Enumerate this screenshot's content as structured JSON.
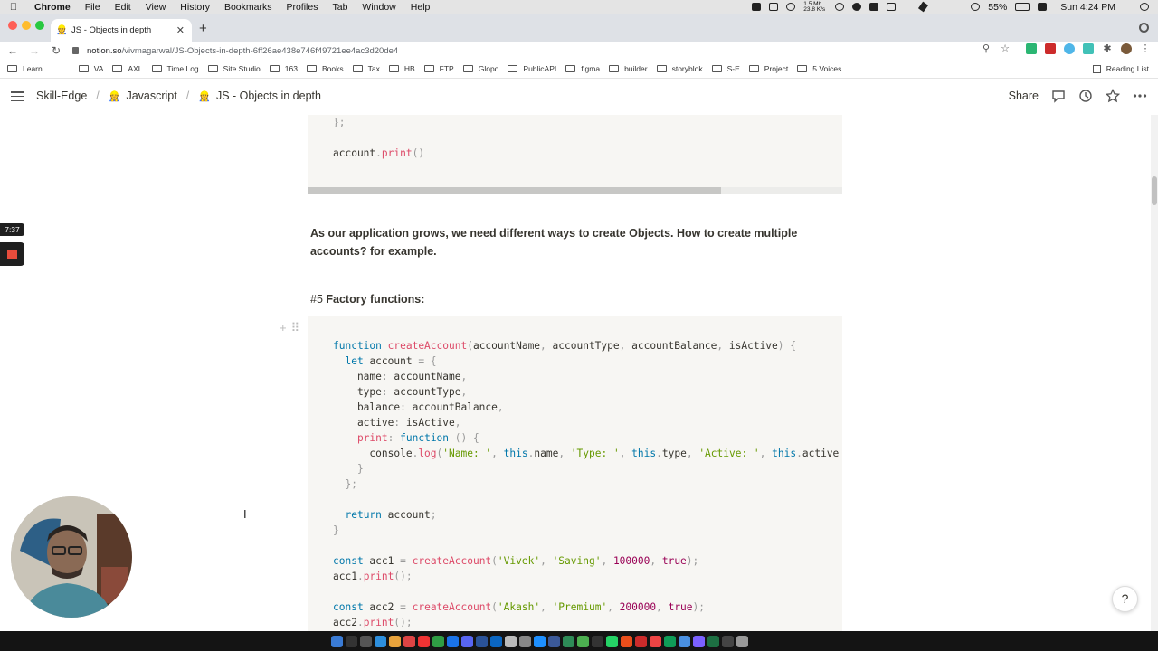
{
  "menubar": {
    "app_name": "Chrome",
    "menus": [
      "File",
      "Edit",
      "View",
      "History",
      "Bookmarks",
      "Profiles",
      "Tab",
      "Window",
      "Help"
    ],
    "net_up": "1.5 Mb",
    "net_down": "23.8 K/s",
    "battery": "55%",
    "clock": "Sun 4:24 PM"
  },
  "browser": {
    "tab_title": "JS - Objects in depth",
    "url_host": "notion.so",
    "url_path": "/vivmagarwal/JS-Objects-in-depth-6ff26ae438e746f49721ee4ac3d20de4",
    "bookmarks": [
      "Learn",
      "VA",
      "AXL",
      "Time Log",
      "Site Studio",
      "163",
      "Books",
      "Tax",
      "HB",
      "FTP",
      "Glopo",
      "PublicAPI",
      "figma",
      "builder",
      "storyblok",
      "S-E",
      "Project",
      "5 Voices"
    ],
    "reading_list": "Reading List"
  },
  "notion": {
    "breadcrumbs": [
      "Skill-Edge",
      "Javascript",
      "JS - Objects in depth"
    ],
    "share_label": "Share",
    "paragraph": "As our application grows, we need different ways to create Objects. How to create multiple accounts? for example.",
    "heading_prefix": "#5",
    "heading_text": "Factory functions:",
    "help_label": "?"
  },
  "recording": {
    "elapsed": "7:37"
  },
  "code_top": [
    [
      [
        "pun",
        "};"
      ]
    ],
    [],
    [
      [
        "",
        "account"
      ],
      [
        "pun",
        "."
      ],
      [
        "fn",
        "print"
      ],
      [
        "pun",
        "()"
      ]
    ]
  ],
  "code_main": [
    [
      [
        "kw",
        "function"
      ],
      [
        "",
        " "
      ],
      [
        "fn",
        "createAccount"
      ],
      [
        "pun",
        "("
      ],
      [
        "",
        "accountName"
      ],
      [
        "pun",
        ", "
      ],
      [
        "",
        "accountType"
      ],
      [
        "pun",
        ", "
      ],
      [
        "",
        "accountBalance"
      ],
      [
        "pun",
        ", "
      ],
      [
        "",
        "isActive"
      ],
      [
        "pun",
        ") {"
      ]
    ],
    [
      [
        "",
        "  "
      ],
      [
        "kw",
        "let"
      ],
      [
        "",
        " account "
      ],
      [
        "pun",
        "= {"
      ]
    ],
    [
      [
        "",
        "    name"
      ],
      [
        "pun",
        ":"
      ],
      [
        "",
        " accountName"
      ],
      [
        "pun",
        ","
      ]
    ],
    [
      [
        "",
        "    type"
      ],
      [
        "pun",
        ":"
      ],
      [
        "",
        " accountType"
      ],
      [
        "pun",
        ","
      ]
    ],
    [
      [
        "",
        "    balance"
      ],
      [
        "pun",
        ":"
      ],
      [
        "",
        " accountBalance"
      ],
      [
        "pun",
        ","
      ]
    ],
    [
      [
        "",
        "    active"
      ],
      [
        "pun",
        ":"
      ],
      [
        "",
        " isActive"
      ],
      [
        "pun",
        ","
      ]
    ],
    [
      [
        "",
        "    "
      ],
      [
        "fn",
        "print"
      ],
      [
        "pun",
        ":"
      ],
      [
        "",
        " "
      ],
      [
        "kw",
        "function"
      ],
      [
        "pun",
        " () {"
      ]
    ],
    [
      [
        "",
        "      console"
      ],
      [
        "pun",
        "."
      ],
      [
        "fn",
        "log"
      ],
      [
        "pun",
        "("
      ],
      [
        "str",
        "'Name: '"
      ],
      [
        "pun",
        ", "
      ],
      [
        "kw",
        "this"
      ],
      [
        "pun",
        "."
      ],
      [
        "",
        "name"
      ],
      [
        "pun",
        ", "
      ],
      [
        "str",
        "'Type: '"
      ],
      [
        "pun",
        ", "
      ],
      [
        "kw",
        "this"
      ],
      [
        "pun",
        "."
      ],
      [
        "",
        "type"
      ],
      [
        "pun",
        ", "
      ],
      [
        "str",
        "'Active: '"
      ],
      [
        "pun",
        ", "
      ],
      [
        "kw",
        "this"
      ],
      [
        "pun",
        "."
      ],
      [
        "",
        "active"
      ]
    ],
    [
      [
        "pun",
        "    }"
      ]
    ],
    [
      [
        "pun",
        "  };"
      ]
    ],
    [],
    [
      [
        "",
        "  "
      ],
      [
        "kw",
        "return"
      ],
      [
        "",
        " account"
      ],
      [
        "pun",
        ";"
      ]
    ],
    [
      [
        "pun",
        "}"
      ]
    ],
    [],
    [
      [
        "kw",
        "const"
      ],
      [
        "",
        " acc1 "
      ],
      [
        "pun",
        "="
      ],
      [
        "",
        " "
      ],
      [
        "fn",
        "createAccount"
      ],
      [
        "pun",
        "("
      ],
      [
        "str",
        "'Vivek'"
      ],
      [
        "pun",
        ", "
      ],
      [
        "str",
        "'Saving'"
      ],
      [
        "pun",
        ", "
      ],
      [
        "num",
        "100000"
      ],
      [
        "pun",
        ", "
      ],
      [
        "num",
        "true"
      ],
      [
        "pun",
        ");"
      ]
    ],
    [
      [
        "",
        "acc1"
      ],
      [
        "pun",
        "."
      ],
      [
        "fn",
        "print"
      ],
      [
        "pun",
        "();"
      ]
    ],
    [],
    [
      [
        "kw",
        "const"
      ],
      [
        "",
        " acc2 "
      ],
      [
        "pun",
        "="
      ],
      [
        "",
        " "
      ],
      [
        "fn",
        "createAccount"
      ],
      [
        "pun",
        "("
      ],
      [
        "str",
        "'Akash'"
      ],
      [
        "pun",
        ", "
      ],
      [
        "str",
        "'Premium'"
      ],
      [
        "pun",
        ", "
      ],
      [
        "num",
        "200000"
      ],
      [
        "pun",
        ", "
      ],
      [
        "num",
        "true"
      ],
      [
        "pun",
        ");"
      ]
    ],
    [
      [
        "",
        "acc2"
      ],
      [
        "pun",
        "."
      ],
      [
        "fn",
        "print"
      ],
      [
        "pun",
        "();"
      ]
    ]
  ]
}
